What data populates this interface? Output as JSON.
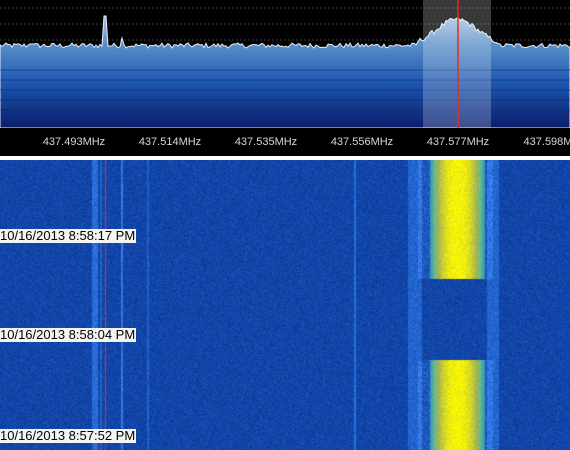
{
  "frequency_axis": {
    "labels": [
      "437.493MHz",
      "437.514MHz",
      "437.535MHz",
      "437.556MHz",
      "437.577MHz",
      "437.598M"
    ]
  },
  "waterfall": {
    "timestamps": [
      "10/16/2013 8:58:17 PM",
      "10/16/2013 8:58:04 PM",
      "10/16/2013 8:57:52 PM"
    ]
  },
  "colors": {
    "background": "#000000",
    "spectrum_fill_top": "#8fb4d8",
    "spectrum_fill_bottom": "#0a2a72",
    "tuning_line": "#e03020",
    "waterfall_noise": "#0b2fb8",
    "signal_peak": "#ffe000"
  },
  "icons": {
    "tuning_marker": "vertical-red-line"
  }
}
